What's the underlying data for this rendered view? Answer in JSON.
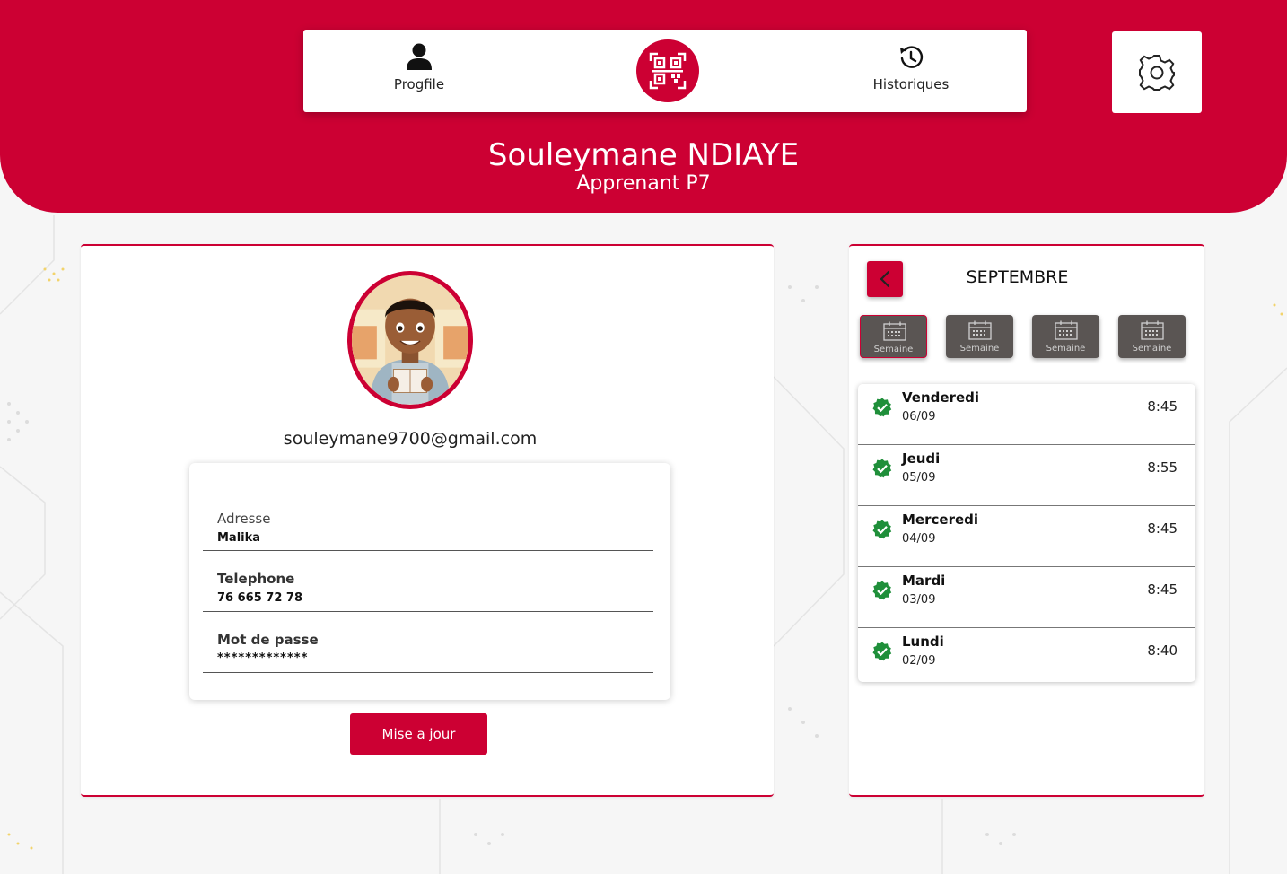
{
  "header": {
    "nav": {
      "profile_label": "Progfile",
      "history_label": "Historiques"
    },
    "user_name": "Souleymane NDIAYE",
    "user_role": "Apprenant P7"
  },
  "profile": {
    "email": "souleymane9700@gmail.com",
    "fields": [
      {
        "label": "Adresse",
        "value": "Malika"
      },
      {
        "label": "Telephone",
        "value": "76 665 72 78"
      },
      {
        "label": "Mot de passe",
        "value": "*************"
      }
    ],
    "update_label": "Mise a jour"
  },
  "calendar": {
    "month": "SEPTEMBRE",
    "weeks": [
      {
        "label": "Semaine"
      },
      {
        "label": "Semaine"
      },
      {
        "label": "Semaine"
      },
      {
        "label": "Semaine"
      }
    ],
    "attendance": [
      {
        "day": "Venderedi",
        "date": "06/09",
        "time": "8:45"
      },
      {
        "day": "Jeudi",
        "date": "05/09",
        "time": "8:55"
      },
      {
        "day": "Merceredi",
        "date": "04/09",
        "time": "8:45"
      },
      {
        "day": "Mardi",
        "date": "03/09",
        "time": "8:45"
      },
      {
        "day": "Lundi",
        "date": "02/09",
        "time": "8:40"
      }
    ]
  },
  "colors": {
    "brand": "#cc0033",
    "week_button": "#5a5553",
    "check": "#1f8f3a"
  },
  "icons": {
    "profile": "person-icon",
    "qr": "qr-code-icon",
    "history": "history-icon",
    "settings": "gear-icon",
    "back": "chevron-left-icon",
    "week": "calendar-icon",
    "attendance": "check-badge-icon"
  }
}
